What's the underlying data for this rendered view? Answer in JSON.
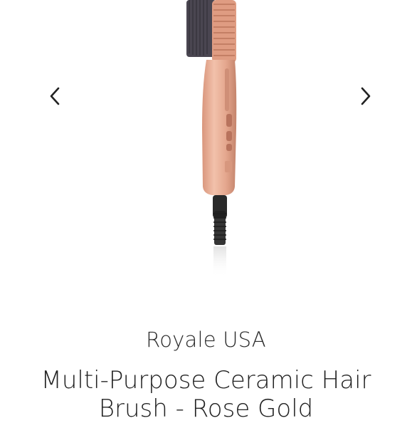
{
  "carousel": {
    "prev_icon": "chevron-left-icon",
    "next_icon": "chevron-right-icon",
    "image_subject": "hair-brush-straightener",
    "colors": {
      "body": "#e8ab93",
      "body_shade": "#c98a72",
      "bristles": "#4a4651",
      "cord": "#1f1f1f"
    }
  },
  "product": {
    "brand": "Royale USA",
    "title": "Multi-Purpose Ceramic Hair Brush - Rose Gold"
  }
}
